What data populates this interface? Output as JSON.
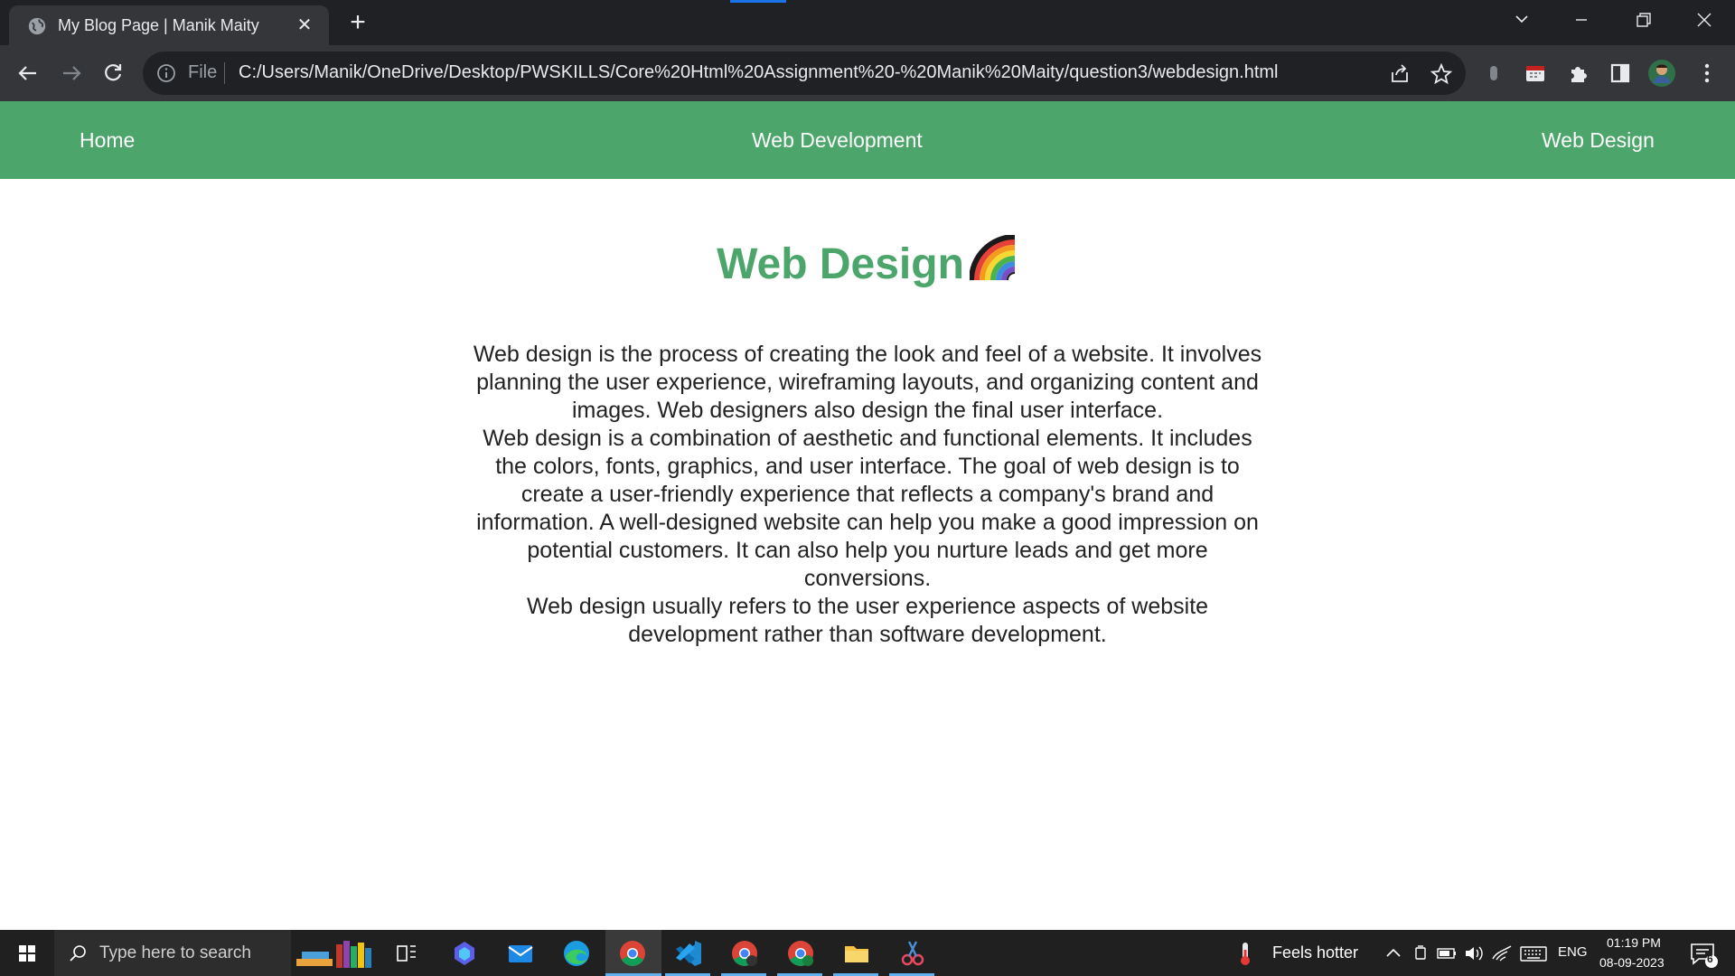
{
  "browser": {
    "tab_title": "My Blog Page | Manik Maity",
    "omnibox_file_label": "File",
    "url": "C:/Users/Manik/OneDrive/Desktop/PWSKILLS/Core%20Html%20Assignment%20-%20Manik%20Maity/question3/webdesign.html",
    "icons": [
      "globe-icon",
      "close-icon",
      "plus-icon",
      "back-icon",
      "forward-icon",
      "reload-icon",
      "info-icon",
      "share-icon",
      "star-icon",
      "extensions-icon",
      "side-panel-icon",
      "profile-avatar",
      "menu-icon"
    ]
  },
  "page": {
    "nav": {
      "home": "Home",
      "web_development": "Web Development",
      "web_design": "Web Design"
    },
    "heading": "Web Design",
    "paragraphs": [
      "Web design is the process of creating the look and feel of a website. It involves planning the user experience, wireframing layouts, and organizing content and images. Web designers also design the final user interface.",
      "Web design is a combination of aesthetic and functional elements. It includes the colors, fonts, graphics, and user interface. The goal of web design is to create a user-friendly experience that reflects a company's brand and information. A well-designed website can help you make a good impression on potential customers. It can also help you nurture leads and get more conversions.",
      "Web design usually refers to the user experience aspects of website development rather than software development."
    ],
    "colors": {
      "accent": "#4ca56a",
      "text": "#222222"
    }
  },
  "taskbar": {
    "search_placeholder": "Type here to search",
    "weather": "Feels hotter",
    "language": "ENG",
    "time": "01:19 PM",
    "date": "08-09-2023",
    "notifications_count": "6"
  }
}
